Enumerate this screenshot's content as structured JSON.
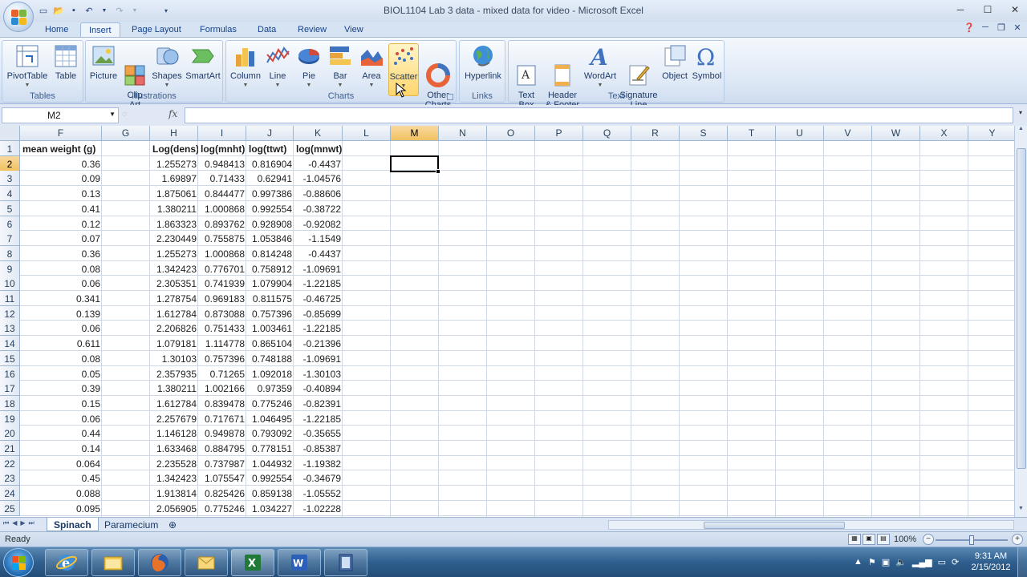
{
  "window": {
    "title": "BIOL1104 Lab 3 data - mixed data for video - Microsoft Excel",
    "controls": [
      "minimize",
      "maximize",
      "close"
    ]
  },
  "ribbon": {
    "tabs": [
      "Home",
      "Insert",
      "Page Layout",
      "Formulas",
      "Data",
      "Review",
      "View"
    ],
    "active_tab": "Insert",
    "groups": {
      "tables": {
        "label": "Tables",
        "buttons": [
          "PivotTable",
          "Table"
        ]
      },
      "illustrations": {
        "label": "Illustrations",
        "buttons": [
          "Picture",
          "Clip\nArt",
          "Shapes",
          "SmartArt"
        ]
      },
      "charts": {
        "label": "Charts",
        "buttons": [
          "Column",
          "Line",
          "Pie",
          "Bar",
          "Area",
          "Scatter",
          "Other\nCharts"
        ]
      },
      "links": {
        "label": "Links",
        "buttons": [
          "Hyperlink"
        ]
      },
      "text": {
        "label": "Text",
        "buttons": [
          "Text\nBox",
          "Header\n& Footer",
          "WordArt",
          "Signature\nLine",
          "Object",
          "Symbol"
        ]
      }
    }
  },
  "formula_bar": {
    "name_box": "M2",
    "fx": "fx",
    "formula": ""
  },
  "grid": {
    "columns": [
      "F",
      "G",
      "H",
      "I",
      "J",
      "K",
      "L",
      "M",
      "N",
      "O",
      "P",
      "Q",
      "R",
      "S",
      "T",
      "U",
      "V",
      "W",
      "X",
      "Y"
    ],
    "selected_column": "M",
    "selected_row": 2,
    "row_numbers": [
      1,
      2,
      3,
      4,
      5,
      6,
      7,
      8,
      9,
      10,
      11,
      12,
      13,
      14,
      15,
      16,
      17,
      18,
      19,
      20,
      21,
      22,
      23,
      24,
      25
    ],
    "headers": {
      "F": "mean weight (g)",
      "H": "Log(dens)",
      "I": "log(mnht)",
      "J": "log(ttwt)",
      "K": "log(mnwt)"
    },
    "rows": [
      [
        "0.36",
        "1.255273",
        "0.948413",
        "0.816904",
        "-0.4437"
      ],
      [
        "0.09",
        "1.69897",
        "0.71433",
        "0.62941",
        "-1.04576"
      ],
      [
        "0.13",
        "1.875061",
        "0.844477",
        "0.997386",
        "-0.88606"
      ],
      [
        "0.41",
        "1.380211",
        "1.000868",
        "0.992554",
        "-0.38722"
      ],
      [
        "0.12",
        "1.863323",
        "0.893762",
        "0.928908",
        "-0.92082"
      ],
      [
        "0.07",
        "2.230449",
        "0.755875",
        "1.053846",
        "-1.1549"
      ],
      [
        "0.36",
        "1.255273",
        "1.000868",
        "0.814248",
        "-0.4437"
      ],
      [
        "0.08",
        "1.342423",
        "0.776701",
        "0.758912",
        "-1.09691"
      ],
      [
        "0.06",
        "2.305351",
        "0.741939",
        "1.079904",
        "-1.22185"
      ],
      [
        "0.341",
        "1.278754",
        "0.969183",
        "0.811575",
        "-0.46725"
      ],
      [
        "0.139",
        "1.612784",
        "0.873088",
        "0.757396",
        "-0.85699"
      ],
      [
        "0.06",
        "2.206826",
        "0.751433",
        "1.003461",
        "-1.22185"
      ],
      [
        "0.611",
        "1.079181",
        "1.114778",
        "0.865104",
        "-0.21396"
      ],
      [
        "0.08",
        "1.30103",
        "0.757396",
        "0.748188",
        "-1.09691"
      ],
      [
        "0.05",
        "2.357935",
        "0.71265",
        "1.092018",
        "-1.30103"
      ],
      [
        "0.39",
        "1.380211",
        "1.002166",
        "0.97359",
        "-0.40894"
      ],
      [
        "0.15",
        "1.612784",
        "0.839478",
        "0.775246",
        "-0.82391"
      ],
      [
        "0.06",
        "2.257679",
        "0.717671",
        "1.046495",
        "-1.22185"
      ],
      [
        "0.44",
        "1.146128",
        "0.949878",
        "0.793092",
        "-0.35655"
      ],
      [
        "0.14",
        "1.633468",
        "0.884795",
        "0.778151",
        "-0.85387"
      ],
      [
        "0.064",
        "2.235528",
        "0.737987",
        "1.044932",
        "-1.19382"
      ],
      [
        "0.45",
        "1.342423",
        "1.075547",
        "0.992554",
        "-0.34679"
      ],
      [
        "0.088",
        "1.913814",
        "0.825426",
        "0.859138",
        "-1.05552"
      ],
      [
        "0.095",
        "2.056905",
        "0.775246",
        "1.034227",
        "-1.02228"
      ]
    ]
  },
  "sheets": {
    "tabs": [
      "Spinach",
      "Paramecium"
    ],
    "active": "Spinach"
  },
  "status": {
    "text": "Ready",
    "zoom": "100%",
    "zoom_level_percent": 100
  },
  "taskbar": {
    "apps": [
      "internet-explorer",
      "windows-explorer",
      "firefox",
      "outlook",
      "excel",
      "word",
      "media-player"
    ],
    "time": "9:31 AM",
    "date": "2/15/2012"
  }
}
